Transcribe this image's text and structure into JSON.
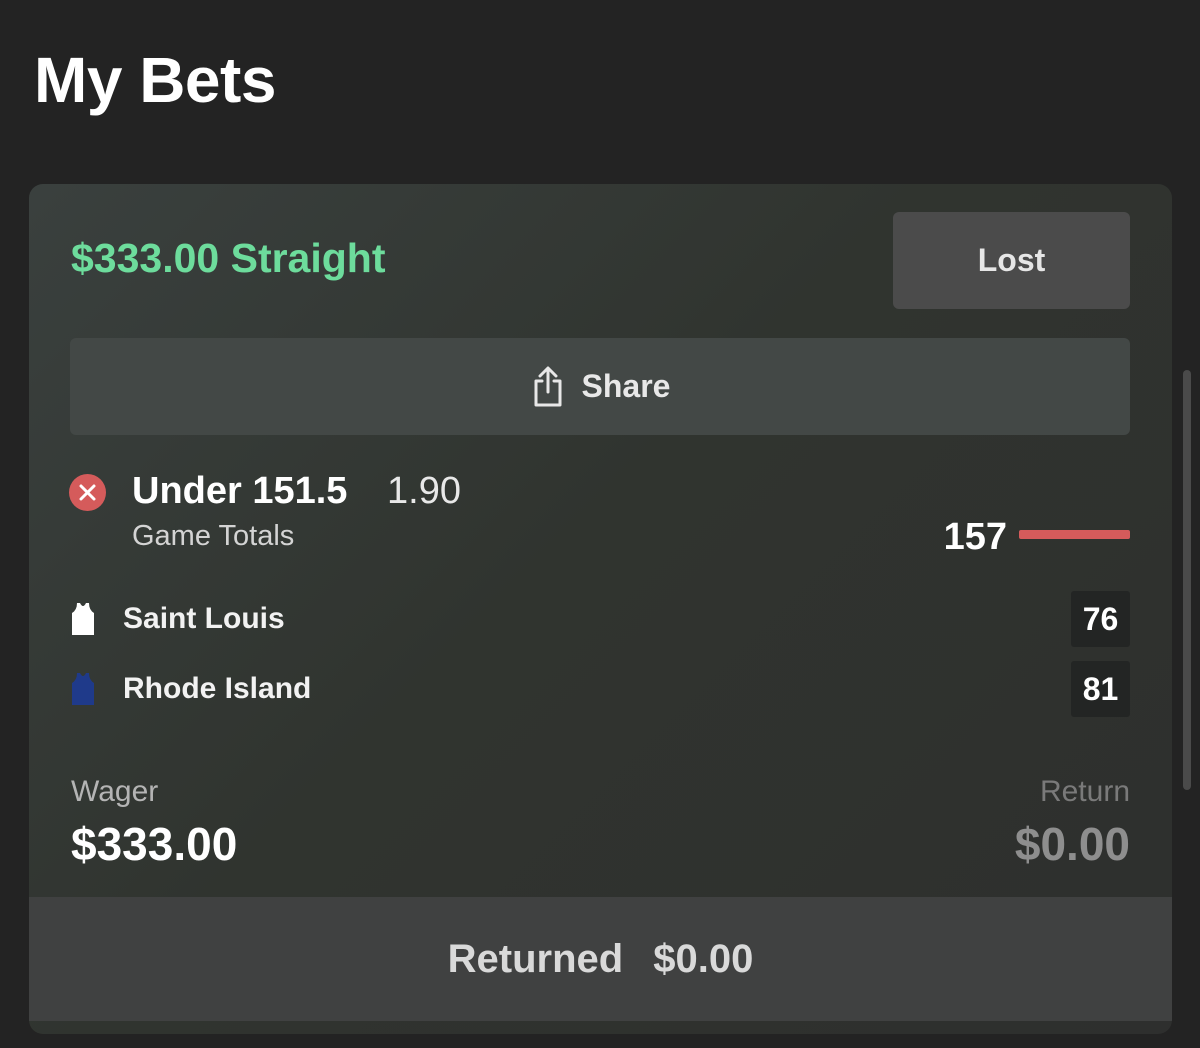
{
  "header": {
    "title": "My Bets"
  },
  "bet": {
    "title": "$333.00 Straight",
    "status": "Lost",
    "share_label": "Share",
    "selection": "Under 151.5",
    "odds": "1.90",
    "market": "Game Totals",
    "total_score": "157",
    "teams": [
      {
        "name": "Saint Louis",
        "score": "76",
        "jersey_color": "#ffffff",
        "jersey_icon": "white-jersey-icon"
      },
      {
        "name": "Rhode Island",
        "score": "81",
        "jersey_color": "#1f3a8a",
        "jersey_icon": "navy-jersey-icon"
      }
    ],
    "wager_label": "Wager",
    "wager_value": "$333.00",
    "return_label": "Return",
    "return_value": "$0.00",
    "returned_label": "Returned",
    "returned_value": "$0.00"
  },
  "colors": {
    "accent_green": "#6ddc9c",
    "lost_red": "#d55b5b",
    "background": "#232323"
  }
}
